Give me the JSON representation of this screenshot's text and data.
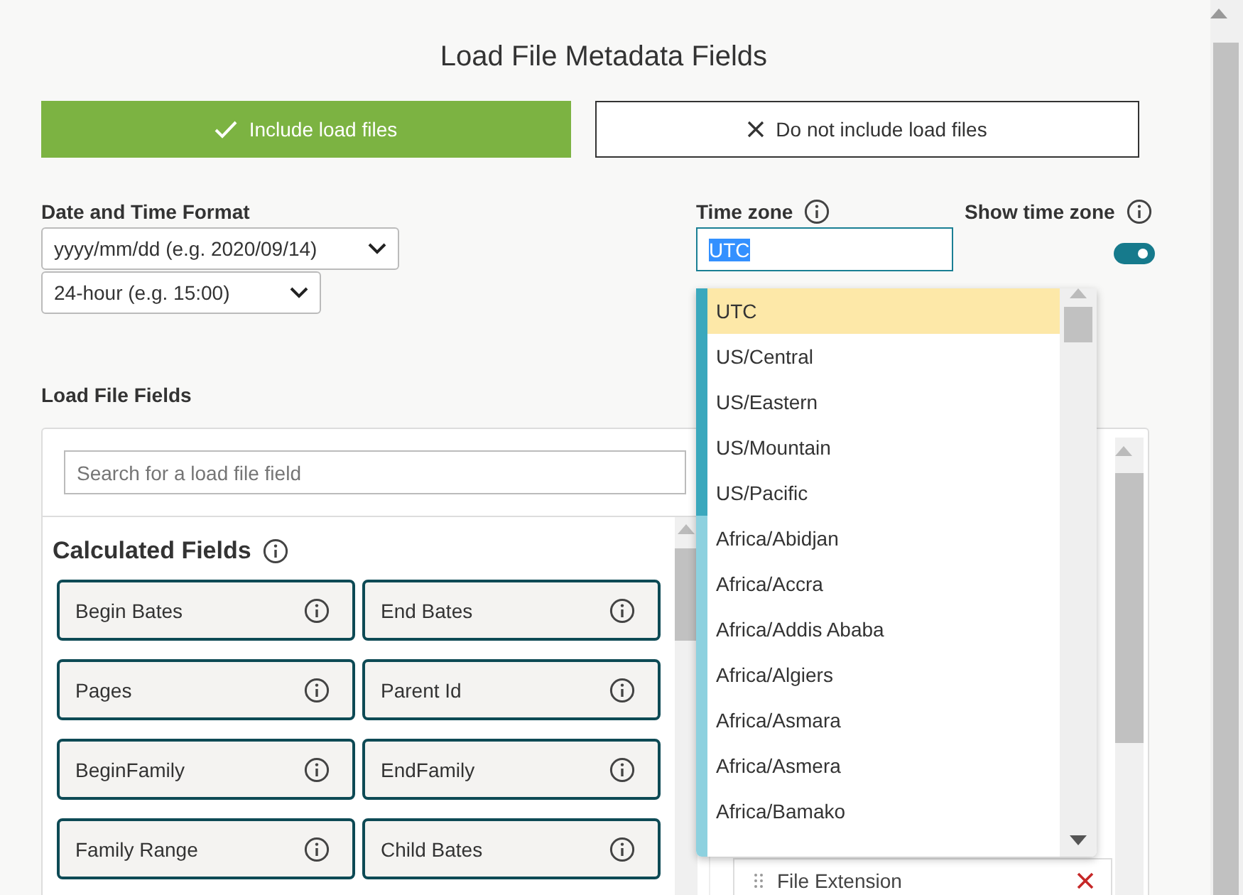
{
  "title": "Load File Metadata Fields",
  "buttons": [
    {
      "label": "Include load files",
      "kind": "include",
      "selected": true
    },
    {
      "label": "Do not include load files",
      "kind": "exclude",
      "selected": false
    }
  ],
  "date_time_format": {
    "label": "Date and Time Format",
    "date_select": "yyyy/mm/dd (e.g. 2020/09/14)",
    "time_select": "24-hour (e.g. 15:00)"
  },
  "time_zone": {
    "label": "Time zone",
    "value": "UTC",
    "options": [
      {
        "label": "UTC",
        "selected": true
      },
      {
        "label": "US/Central",
        "selected": false
      },
      {
        "label": "US/Eastern",
        "selected": false
      },
      {
        "label": "US/Mountain",
        "selected": false
      },
      {
        "label": "US/Pacific",
        "selected": false
      },
      {
        "label": "Africa/Abidjan",
        "selected": false
      },
      {
        "label": "Africa/Accra",
        "selected": false
      },
      {
        "label": "Africa/Addis Ababa",
        "selected": false
      },
      {
        "label": "Africa/Algiers",
        "selected": false
      },
      {
        "label": "Africa/Asmara",
        "selected": false
      },
      {
        "label": "Africa/Asmera",
        "selected": false
      },
      {
        "label": "Africa/Bamako",
        "selected": false
      }
    ]
  },
  "show_time_zone": {
    "label": "Show time zone",
    "on": true
  },
  "load_file_fields": {
    "label": "Load File Fields",
    "search": {
      "placeholder": "Search for a load file field"
    },
    "calculated_fields": {
      "title": "Calculated Fields",
      "items": [
        "Begin Bates",
        "End Bates",
        "Pages",
        "Parent Id",
        "BeginFamily",
        "EndFamily",
        "Family Range",
        "Child Bates"
      ]
    },
    "selected_fields": [
      {
        "label": "File Extension"
      }
    ]
  }
}
